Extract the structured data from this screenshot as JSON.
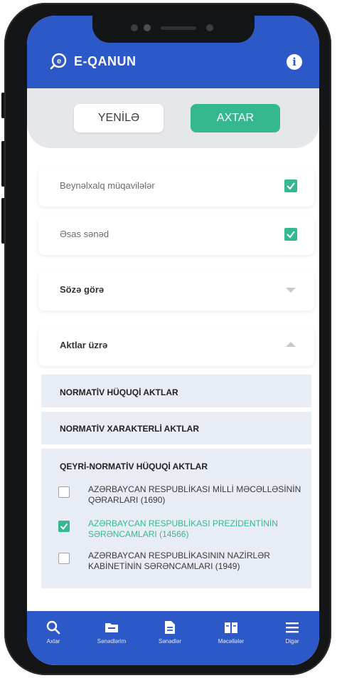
{
  "app": {
    "brand": "E-QANUN",
    "brand_color": "#2d58c8",
    "accent_color": "#35b890"
  },
  "actions": {
    "reset_label": "YENİLƏ",
    "search_label": "AXTAR"
  },
  "filters": {
    "international": {
      "label": "Beynəlxalq müqavilələr",
      "checked": true
    },
    "main_doc": {
      "label": "Əsas sənəd",
      "checked": true
    },
    "by_word": {
      "label": "Sözə görə",
      "expanded": false
    },
    "by_acts": {
      "label": "Aktlar üzrə",
      "expanded": true
    }
  },
  "acts": {
    "normative": "NORMATİV HÜQUQİ AKTLAR",
    "normative_character": "NORMATİV XARAKTERLİ AKTLAR",
    "non_normative": "QEYRİ-NORMATİV HÜQUQİ AKTLAR",
    "items": [
      {
        "label": "AZƏRBAYCAN RESPUBLİKASI MİLLİ MƏCƏLLƏSİNİN QƏRARLARI (1690)",
        "checked": false
      },
      {
        "label": "AZƏRBAYCAN RESPUBLİKASI PREZİDENTİNİN SƏRƏNCAMLARI (14566)",
        "checked": true
      },
      {
        "label": "AZƏRBAYCAN RESPUBLİKASININ NAZİRLƏR KABİNETİNİN SƏRƏNCAMLARI (1949)",
        "checked": false
      }
    ]
  },
  "nav": {
    "items": [
      {
        "label": "Axtar",
        "icon": "search-icon"
      },
      {
        "label": "Sənədlərim",
        "icon": "folder-icon"
      },
      {
        "label": "Sənədlər",
        "icon": "document-icon"
      },
      {
        "label": "Məcəllələr",
        "icon": "book-icon"
      },
      {
        "label": "Digər",
        "icon": "menu-icon"
      }
    ]
  }
}
